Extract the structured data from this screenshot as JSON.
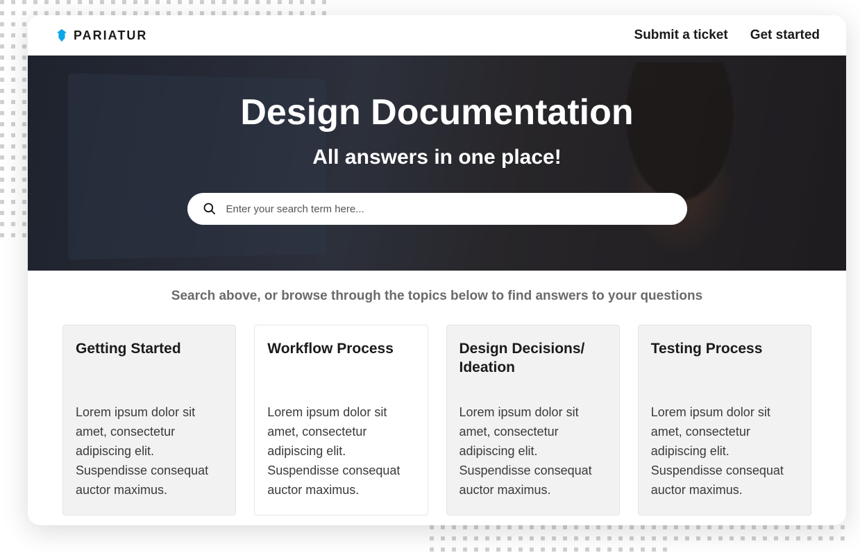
{
  "header": {
    "logo_text": "PARIATUR",
    "nav": {
      "submit_ticket": "Submit a ticket",
      "get_started": "Get started"
    }
  },
  "hero": {
    "title": "Design Documentation",
    "subtitle": "All answers in one place!",
    "search_placeholder": "Enter your search term here..."
  },
  "content": {
    "helper": "Search above, or browse through the topics below to find answers to your questions",
    "cards": [
      {
        "title": "Getting Started",
        "desc": "Lorem ipsum dolor sit amet, consectetur adipiscing elit. Suspendisse consequat auctor maximus."
      },
      {
        "title": "Workflow Process",
        "desc": "Lorem ipsum dolor sit amet, consectetur adipiscing elit. Suspendisse consequat auctor maximus."
      },
      {
        "title": "Design Decisions/ Ideation",
        "desc": "Lorem ipsum dolor sit amet, consectetur adipiscing elit. Suspendisse consequat auctor maximus."
      },
      {
        "title": "Testing Process",
        "desc": "Lorem ipsum dolor sit amet, consectetur adipiscing elit. Suspendisse consequat auctor maximus."
      }
    ]
  }
}
